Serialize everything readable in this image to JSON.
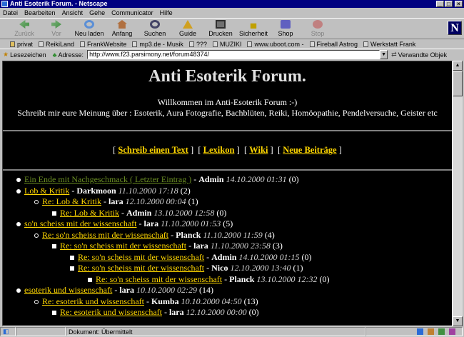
{
  "window": {
    "title": "Anti Esoterik Forum. - Netscape",
    "min_glyph": "_",
    "max_glyph": "□",
    "close_glyph": "×"
  },
  "menu": [
    "Datei",
    "Bearbeiten",
    "Ansicht",
    "Gehe",
    "Communicator",
    "Hilfe"
  ],
  "toolbar": {
    "back": "Zurück",
    "forward": "Vor",
    "reload": "Neu laden",
    "home": "Anfang",
    "search": "Suchen",
    "guide": "Guide",
    "print": "Drucken",
    "security": "Sicherheit",
    "shop": "Shop",
    "stop": "Stop",
    "logo": "N"
  },
  "bookmarks": [
    "privat",
    "ReikiLand",
    "FrankWebsite",
    "mp3.de - Musik",
    "???",
    "MUZIKI",
    "www.uboot.com -",
    "Fireball Astrog",
    "Werkstatt Frank"
  ],
  "location": {
    "bookmarks_label": "Lesezeichen",
    "address_label": "Adresse:",
    "url": "http://www.f23.parsimony.net/forum48374/",
    "related_label": "Verwandte Objek"
  },
  "page": {
    "title": "Anti Esoterik Forum.",
    "welcome_line1": "Willkommen im Anti-Esoterik Forum :-)",
    "welcome_line2": "Schreibt mir eure Meinung über : Esoterik, Aura Fotografie, Bachblüten, Reiki, Homöopathie, Pendelversuche, Geister etc",
    "nav": [
      "Schreib einen Text",
      "Lexikon",
      "Wiki",
      "Neue Beiträge"
    ],
    "threads": [
      {
        "level": 0,
        "title": "Ein Ende mit Nachgeschmack ( Letzter Eintrag )",
        "author": "Admin",
        "date": "14.10.2000 01:31",
        "count": "(0)",
        "visited": true
      },
      {
        "level": 0,
        "title": "Lob & Kritik",
        "author": "Darkmoon",
        "date": "11.10.2000 17:18",
        "count": "(2)"
      },
      {
        "level": 1,
        "title": "Re: Lob & Kritik",
        "author": "lara",
        "date": "12.10.2000 00:04",
        "count": "(1)"
      },
      {
        "level": 2,
        "title": "Re: Lob & Kritik",
        "author": "Admin",
        "date": "13.10.2000 12:58",
        "count": "(0)"
      },
      {
        "level": 0,
        "title": "so'n scheiss mit der wissenschaft",
        "author": "lara",
        "date": "11.10.2000 01:53",
        "count": "(5)"
      },
      {
        "level": 1,
        "title": "Re: so'n scheiss mit der wissenschaft",
        "author": "Planck",
        "date": "11.10.2000 11:59",
        "count": "(4)"
      },
      {
        "level": 2,
        "title": "Re: so'n scheiss mit der wissenschaft",
        "author": "lara",
        "date": "11.10.2000 23:58",
        "count": "(3)"
      },
      {
        "level": 3,
        "title": "Re: so'n scheiss mit der wissenschaft",
        "author": "Admin",
        "date": "14.10.2000 01:15",
        "count": "(0)"
      },
      {
        "level": 3,
        "title": "Re: so'n scheiss mit der wissenschaft",
        "author": "Nico",
        "date": "12.10.2000 13:40",
        "count": "(1)"
      },
      {
        "level": 4,
        "title": "Re: so'n scheiss mit der wissenschaft",
        "author": "Planck",
        "date": "13.10.2000 12:32",
        "count": "(0)"
      },
      {
        "level": 0,
        "title": "esoterik und wissenschaft",
        "author": "lara",
        "date": "10.10.2000 02:29",
        "count": "(14)"
      },
      {
        "level": 1,
        "title": "Re: esoterik und wissenschaft",
        "author": "Kumba",
        "date": "10.10.2000 04:50",
        "count": "(13)"
      },
      {
        "level": 2,
        "title": "Re: esoterik und wissenschaft",
        "author": "lara",
        "date": "12.10.2000 00:00",
        "count": "(0)"
      }
    ]
  },
  "status": {
    "text": "Dokument: Übermittelt"
  },
  "colors": {
    "link": "#ffd700",
    "visited_link": "#6b8e23",
    "titlebar": "#000080",
    "page_bg": "#000000"
  }
}
